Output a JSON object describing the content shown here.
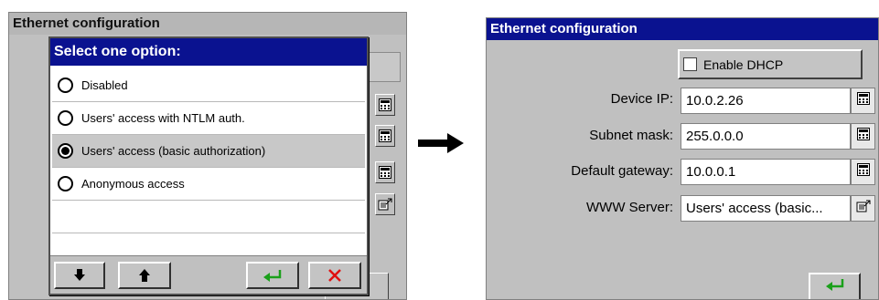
{
  "left_screen": {
    "title": "Ethernet configuration"
  },
  "dialog": {
    "title": "Select one option:",
    "options": [
      {
        "label": "Disabled",
        "selected": false
      },
      {
        "label": "Users' access with NTLM auth.",
        "selected": false
      },
      {
        "label": "Users' access (basic authorization)",
        "selected": true
      },
      {
        "label": "Anonymous access",
        "selected": false
      }
    ],
    "toolbar": {
      "down_icon": "arrow-down-icon",
      "up_icon": "arrow-up-icon",
      "enter_icon": "enter-icon",
      "cancel_icon": "close-icon"
    }
  },
  "right_screen": {
    "title": "Ethernet configuration",
    "dhcp": {
      "label": "Enable DHCP",
      "checked": false
    },
    "fields": [
      {
        "label": "Device IP:",
        "value": "10.0.2.26",
        "icon": "calculator-icon"
      },
      {
        "label": "Subnet mask:",
        "value": "255.0.0.0",
        "icon": "calculator-icon"
      },
      {
        "label": "Default gateway:",
        "value": "10.0.0.1",
        "icon": "calculator-icon"
      },
      {
        "label": "WWW Server:",
        "value": "Users' access (basic...",
        "icon": "list-select-icon"
      }
    ],
    "enter_icon": "enter-icon"
  },
  "colors": {
    "title_bar": "#0a1290",
    "panel": "#c0c0c0",
    "enter_green": "#1aa01a",
    "cancel_red": "#e01010"
  }
}
